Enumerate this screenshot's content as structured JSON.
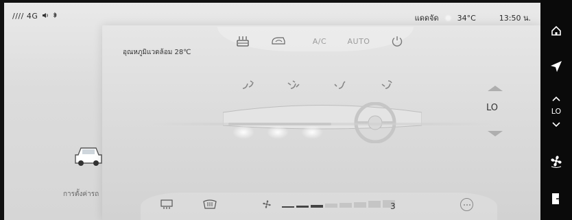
{
  "status_bar": {
    "signal": "//// 4G",
    "weather_label": "แดดจัด",
    "temperature": "34°C",
    "time": "13:50 น."
  },
  "background": {
    "car_settings_label": "การตั้งค่ารถ"
  },
  "climate": {
    "outside_temp_label": "อุณหภูมิแวดล้อม 28℃",
    "top_buttons": {
      "rear_defrost": "rear-defrost-icon",
      "recirculation": "recirculation-icon",
      "ac_label": "A/C",
      "auto_label": "AUTO",
      "power": "power-icon"
    },
    "fan_setting": "LO",
    "fan_speed_value": "3",
    "fan_speed_level": 0.3,
    "bottom_icons": [
      "seat-heat-icon",
      "windshield-defrost-icon",
      "fan-icon",
      "more-icon"
    ],
    "colors": {
      "inactive": "#9b9b9b",
      "active": "#333333",
      "glow": "#ffffff"
    }
  },
  "dock": {
    "items": [
      "home-icon",
      "navigation-icon",
      "up-chevron-icon",
      "down-chevron-icon",
      "fan-icon",
      "exit-icon"
    ],
    "fan_label": "LO"
  }
}
